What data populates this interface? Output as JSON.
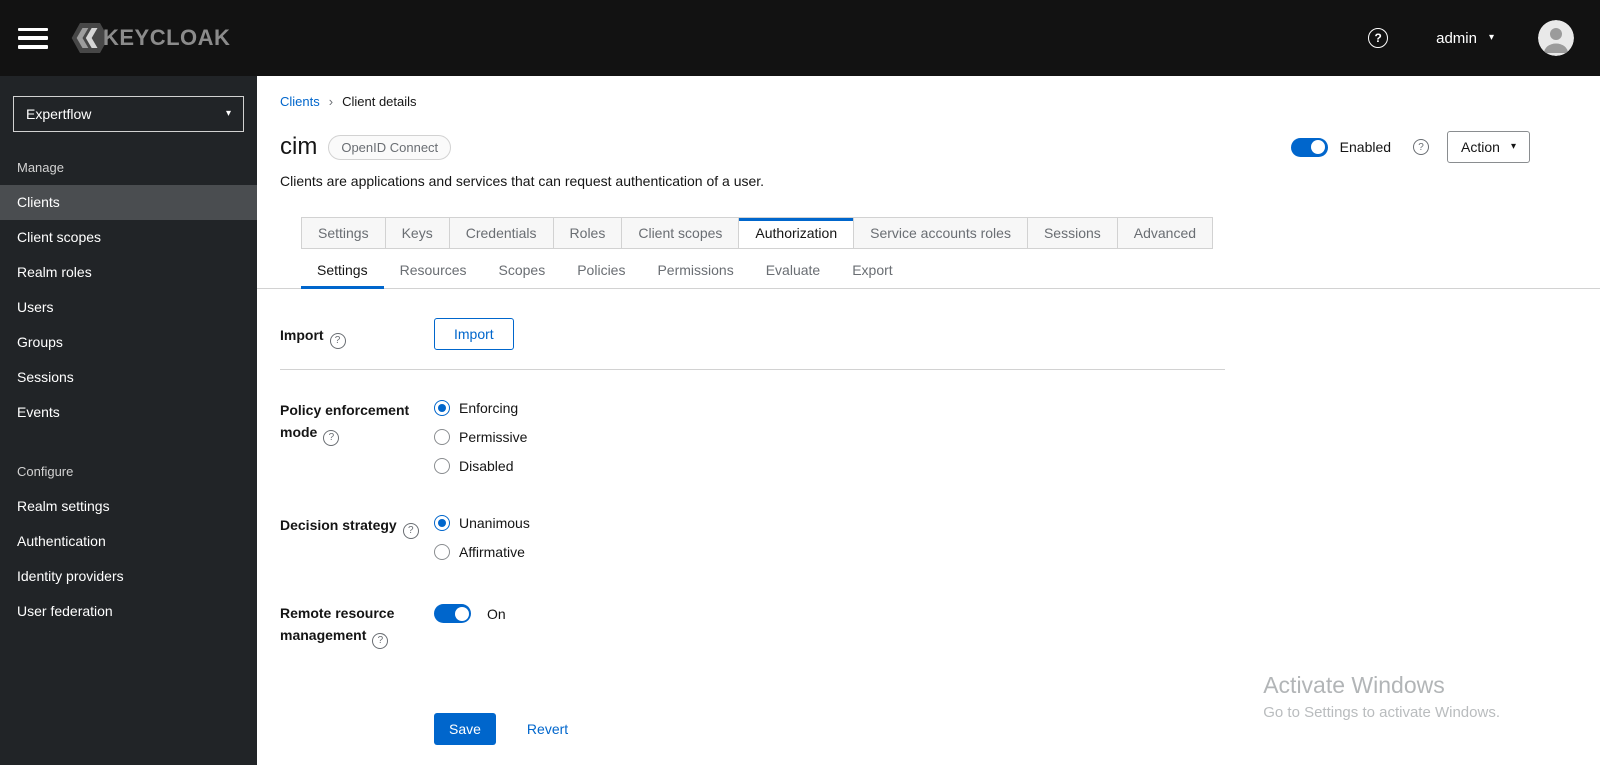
{
  "icons": {
    "help": "?",
    "caret": "▾"
  },
  "topbar": {
    "brand": "KEYCLOAK",
    "user": "admin"
  },
  "sidebar": {
    "realm": "Expertflow",
    "sections": [
      {
        "label": "Manage",
        "items": [
          "Clients",
          "Client scopes",
          "Realm roles",
          "Users",
          "Groups",
          "Sessions",
          "Events"
        ],
        "selected": "Clients"
      },
      {
        "label": "Configure",
        "items": [
          "Realm settings",
          "Authentication",
          "Identity providers",
          "User federation"
        ]
      }
    ]
  },
  "header": {
    "breadcrumb": {
      "items": [
        "Clients",
        "Client details"
      ],
      "separator": "›"
    },
    "title": "cim",
    "protocol_badge": "OpenID Connect",
    "description": "Clients are applications and services that can request authentication of a user.",
    "enabled_label": "Enabled",
    "enabled_state": "on",
    "action_button": "Action"
  },
  "tabs": {
    "main": [
      "Settings",
      "Keys",
      "Credentials",
      "Roles",
      "Client scopes",
      "Authorization",
      "Service accounts roles",
      "Sessions",
      "Advanced"
    ],
    "active_main": "Authorization",
    "sub": [
      "Settings",
      "Resources",
      "Scopes",
      "Policies",
      "Permissions",
      "Evaluate",
      "Export"
    ],
    "active_sub": "Settings"
  },
  "form": {
    "import": {
      "label": "Import",
      "button_label": "Import"
    },
    "policy_enforcement_mode": {
      "label": "Policy enforcement mode",
      "options": [
        "Enforcing",
        "Permissive",
        "Disabled"
      ],
      "selected": "Enforcing"
    },
    "decision_strategy": {
      "label": "Decision strategy",
      "options": [
        "Unanimous",
        "Affirmative"
      ],
      "selected": "Unanimous"
    },
    "remote_resource_management": {
      "label": "Remote resource management",
      "value": "On",
      "state": "on"
    },
    "actions": {
      "save": "Save",
      "revert": "Revert"
    }
  },
  "watermark": {
    "title": "Activate Windows",
    "subtitle": "Go to Settings to activate Windows."
  },
  "colors": {
    "primary": "#0066cc",
    "topbar": "#121212",
    "sidebar": "#212427",
    "sidebar_selected": "#4a4d50"
  }
}
